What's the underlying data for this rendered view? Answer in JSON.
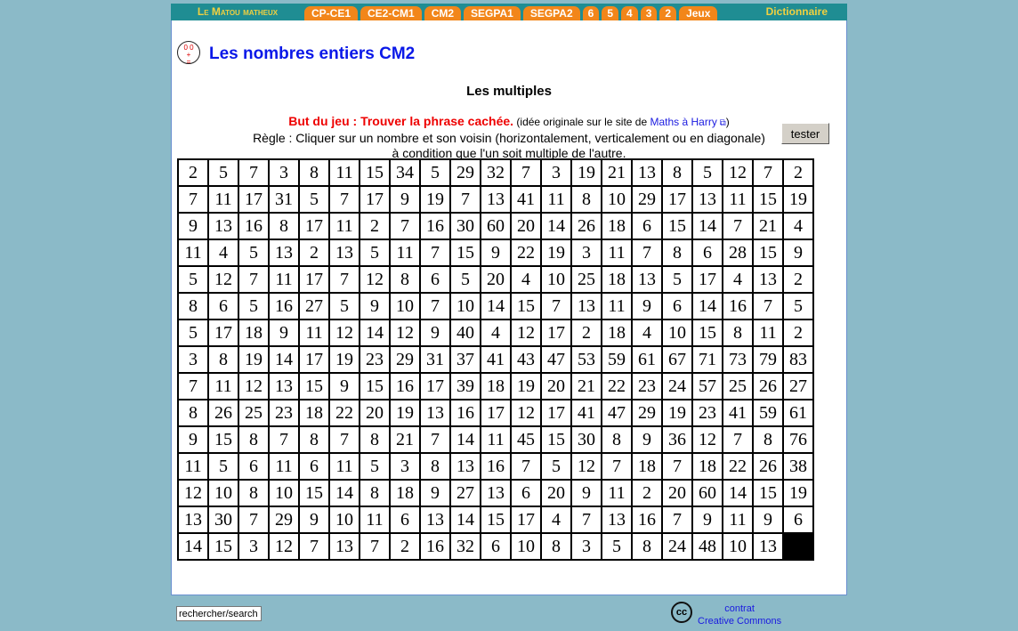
{
  "nav": {
    "brand": "Le Matou matheux",
    "tabs": [
      "CP-CE1",
      "CE2-CM1",
      "CM2",
      "SEGPA1",
      "SEGPA2",
      "6",
      "5",
      "4",
      "3",
      "2",
      "Jeux"
    ],
    "dictionary": "Dictionnaire"
  },
  "header": {
    "logo_text": "0.0 + =",
    "title": "Les nombres entiers CM2"
  },
  "game": {
    "subtitle": "Les multiples",
    "goal": "But du jeu : Trouver la phrase cachée.",
    "credit_prefix": "(idée originale sur le site de ",
    "credit_link": "Maths à Harry",
    "credit_suffix": ")",
    "external_icon": "external-link-icon",
    "rule_line1": "Règle : Cliquer sur un nombre et son voisin (horizontalement, verticalement ou en diagonale)",
    "rule_line2": "à condition que l'un soit multiple de l'autre.",
    "test_button": "tester"
  },
  "grid": [
    [
      2,
      5,
      7,
      3,
      8,
      11,
      15,
      34,
      5,
      29,
      32,
      7,
      3,
      19,
      21,
      13,
      8,
      5,
      12,
      7,
      2
    ],
    [
      7,
      11,
      17,
      31,
      5,
      7,
      17,
      9,
      19,
      7,
      13,
      41,
      11,
      8,
      10,
      29,
      17,
      13,
      11,
      15,
      19
    ],
    [
      9,
      13,
      16,
      8,
      17,
      11,
      2,
      7,
      16,
      30,
      60,
      20,
      14,
      26,
      18,
      6,
      15,
      14,
      7,
      21,
      4
    ],
    [
      11,
      4,
      5,
      13,
      2,
      13,
      5,
      11,
      7,
      15,
      9,
      22,
      19,
      3,
      11,
      7,
      8,
      6,
      28,
      15,
      9
    ],
    [
      5,
      12,
      7,
      11,
      17,
      7,
      12,
      8,
      6,
      5,
      20,
      4,
      10,
      25,
      18,
      13,
      5,
      17,
      4,
      13,
      2
    ],
    [
      8,
      6,
      5,
      16,
      27,
      5,
      9,
      10,
      7,
      10,
      14,
      15,
      7,
      13,
      11,
      9,
      6,
      14,
      16,
      7,
      5
    ],
    [
      5,
      17,
      18,
      9,
      11,
      12,
      14,
      12,
      9,
      40,
      4,
      12,
      17,
      2,
      18,
      4,
      10,
      15,
      8,
      11,
      2
    ],
    [
      3,
      8,
      19,
      14,
      17,
      19,
      23,
      29,
      31,
      37,
      41,
      43,
      47,
      53,
      59,
      61,
      67,
      71,
      73,
      79,
      83
    ],
    [
      7,
      11,
      12,
      13,
      15,
      9,
      15,
      16,
      17,
      39,
      18,
      19,
      20,
      21,
      22,
      23,
      24,
      57,
      25,
      26,
      27
    ],
    [
      8,
      26,
      25,
      23,
      18,
      22,
      20,
      19,
      13,
      16,
      17,
      12,
      17,
      41,
      47,
      29,
      19,
      23,
      41,
      59,
      61
    ],
    [
      9,
      15,
      8,
      7,
      8,
      7,
      8,
      21,
      7,
      14,
      11,
      45,
      15,
      30,
      8,
      9,
      36,
      12,
      7,
      8,
      76
    ],
    [
      11,
      5,
      6,
      11,
      6,
      11,
      5,
      3,
      8,
      13,
      16,
      7,
      5,
      12,
      7,
      18,
      7,
      18,
      22,
      26,
      38
    ],
    [
      12,
      10,
      8,
      10,
      15,
      14,
      8,
      18,
      9,
      27,
      13,
      6,
      20,
      9,
      11,
      2,
      20,
      60,
      14,
      15,
      19
    ],
    [
      13,
      30,
      7,
      29,
      9,
      10,
      11,
      6,
      13,
      14,
      15,
      17,
      4,
      7,
      13,
      16,
      7,
      9,
      11,
      9,
      6
    ],
    [
      14,
      15,
      3,
      12,
      7,
      13,
      7,
      2,
      16,
      32,
      6,
      10,
      8,
      3,
      5,
      8,
      24,
      48,
      10,
      13,
      null
    ]
  ],
  "footer": {
    "search_value": "rechercher/search",
    "cc_logo": "cc",
    "license_line1": "contrat",
    "license_line2": "Creative Commons"
  }
}
